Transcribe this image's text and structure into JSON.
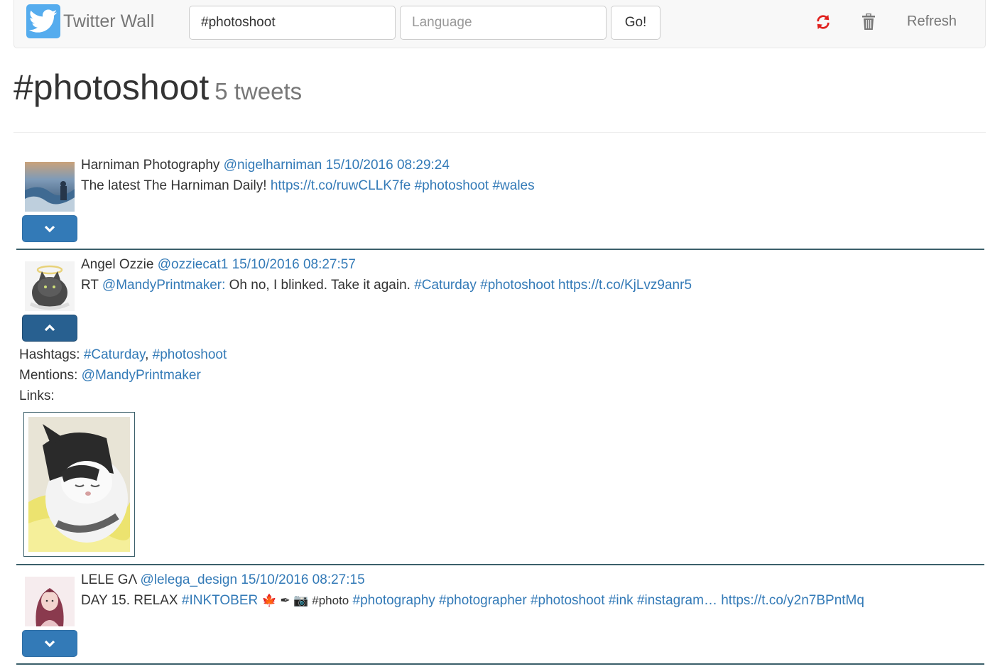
{
  "navbar": {
    "brand": "Twitter Wall",
    "search_value": "#photoshoot",
    "language_placeholder": "Language",
    "go_label": "Go!",
    "refresh_label": "Refresh",
    "colors": {
      "refresh_icon": "#e0201d",
      "trash_icon": "#777777",
      "brand_bg": "#55acee"
    }
  },
  "header": {
    "title": "#photoshoot",
    "count": "5 tweets"
  },
  "tweets": [
    {
      "name": "Harniman Photography",
      "handle": "@nigelharniman",
      "time": "15/10/2016 08:29:24",
      "text_plain": "The latest The Harniman Daily!",
      "link1": "https://t.co/ruwCLLK7fe",
      "tag1": "#photoshoot",
      "tag2": "#wales",
      "toggle_icon": "chevron-down-icon"
    },
    {
      "name": "Angel Ozzie",
      "handle": "@ozziecat1",
      "time": "15/10/2016 08:27:57",
      "rt": "RT",
      "mention": "@MandyPrintmaker:",
      "text_plain": "Oh no, I blinked. Take it again.",
      "tag1": "#Caturday",
      "tag2": "#photoshoot",
      "link1": "https://t.co/KjLvz9anr5",
      "toggle_icon": "chevron-up-icon",
      "details": {
        "hashtags_label": "Hashtags:",
        "hashtags": [
          "#Caturday",
          "#photoshoot"
        ],
        "mentions_label": "Mentions:",
        "mentions": [
          "@MandyPrintmaker"
        ],
        "links_label": "Links:"
      }
    },
    {
      "name": "LELE GΛ",
      "handle": "@lelega_design",
      "time": "15/10/2016 08:27:15",
      "text_plain": "DAY 15. RELAX",
      "tag1": "#INKTOBER",
      "symbols": "🍁 ✒ 📷 #photo",
      "tag2": "#photography",
      "tag3": "#photographer",
      "tag4": "#photoshoot",
      "tag5": "#ink",
      "tag6": "#instagram…",
      "link1": "https://t.co/y2n7BPntMq",
      "toggle_icon": "chevron-down-icon"
    }
  ]
}
